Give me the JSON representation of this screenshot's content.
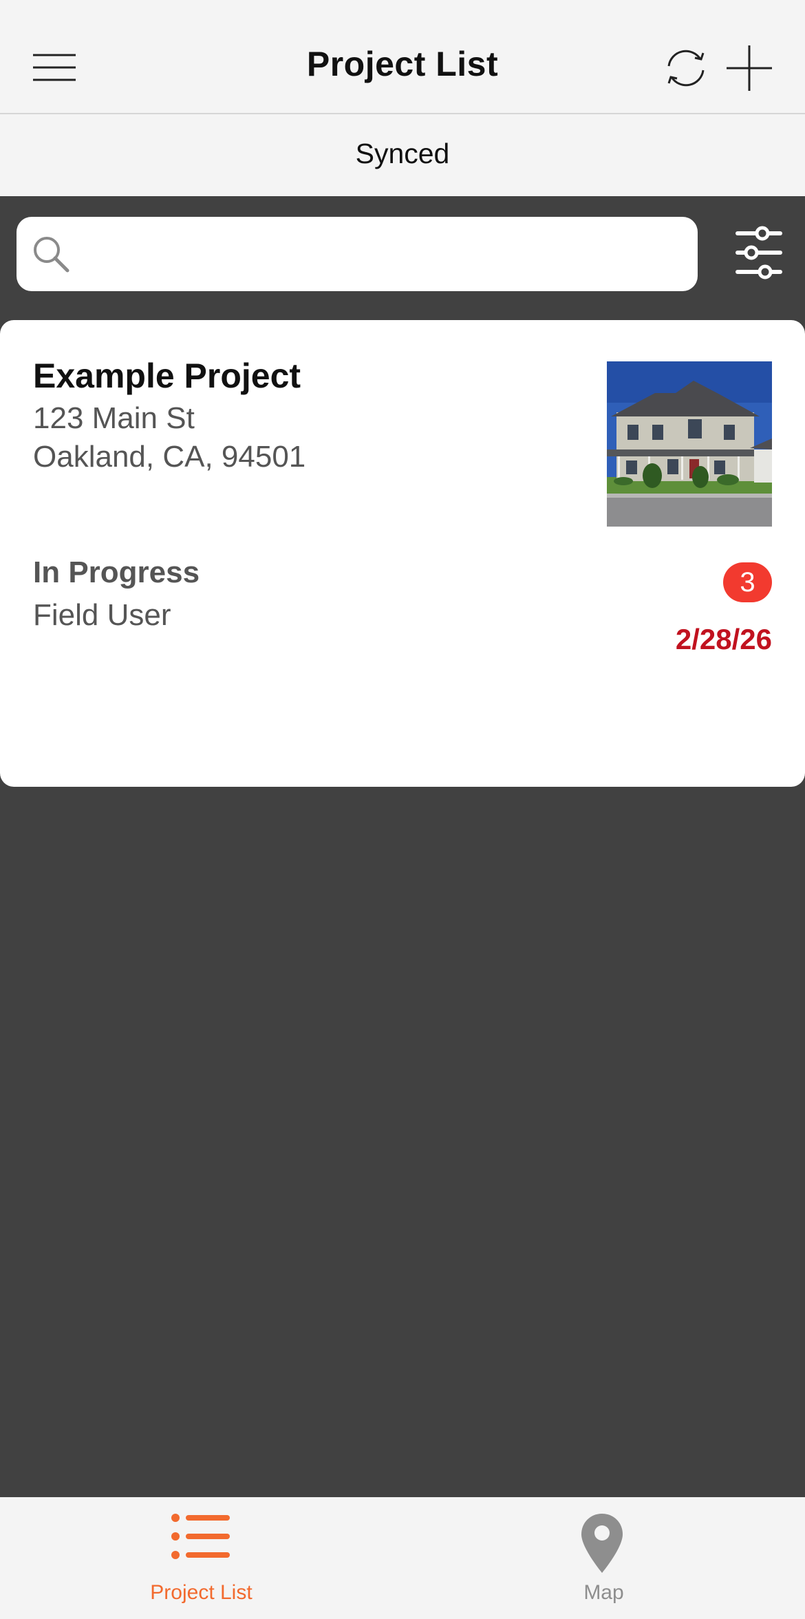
{
  "header": {
    "title": "Project List",
    "menu_icon": "hamburger-menu-icon",
    "sync_icon": "sync-refresh-icon",
    "add_icon": "plus-icon"
  },
  "status": {
    "text": "Synced"
  },
  "search": {
    "placeholder": "",
    "value": "",
    "icon": "search-icon",
    "filter_icon": "filter-sliders-icon"
  },
  "projects": [
    {
      "name": "Example Project",
      "address_line1": "123 Main St",
      "address_line2": "Oakland, CA, 94501",
      "status": "In Progress",
      "assignee": "Field User",
      "badge_count": "3",
      "date": "2/28/26",
      "thumbnail": "house-photo"
    }
  ],
  "tabs": [
    {
      "label": "Project List",
      "icon": "list-icon",
      "active": true
    },
    {
      "label": "Map",
      "icon": "map-pin-icon",
      "active": false
    }
  ],
  "colors": {
    "accent": "#f26a2e",
    "badge": "#f23a2f",
    "date": "#c1121f",
    "background_dark": "#414141",
    "header_bg": "#f4f4f4"
  }
}
